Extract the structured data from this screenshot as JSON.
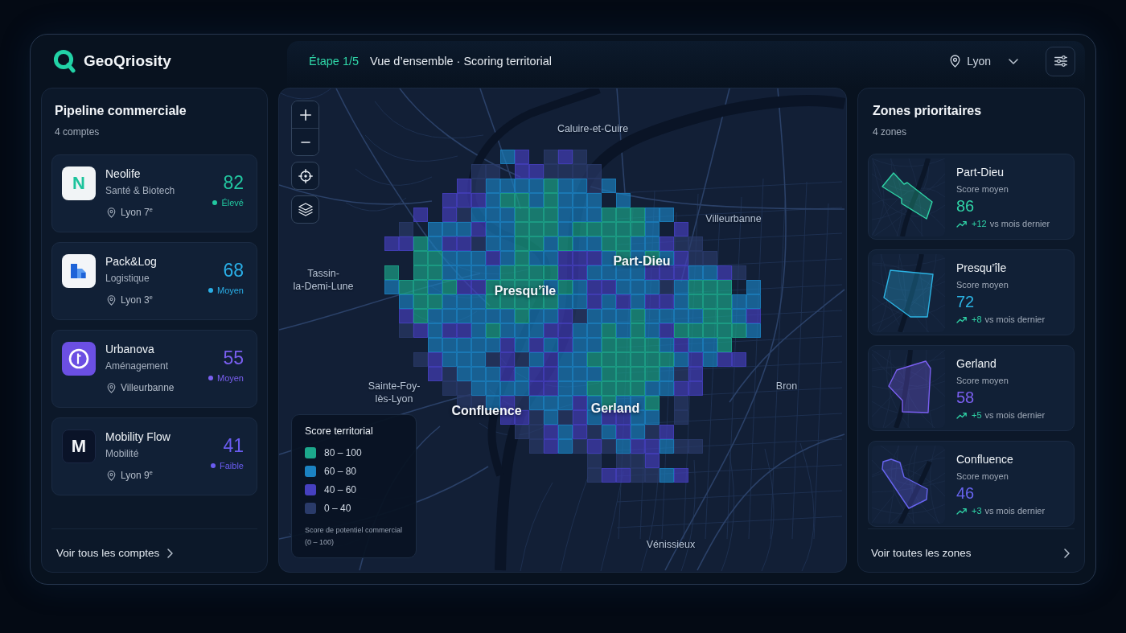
{
  "header": {
    "brand": "GeoQriosity",
    "step": "Étape 1/5",
    "title": "Vue d’ensemble · Scoring territorial",
    "city": "Lyon"
  },
  "pipeline": {
    "title": "Pipeline commerciale",
    "count": "4 comptes",
    "accounts": [
      {
        "name": "Neolife",
        "sector": "Santé & Biotech",
        "location": "Lyon 7$^{e}$",
        "score": "82",
        "status": "Élevé",
        "color": "#22c7a0",
        "logo": {
          "kind": "letter-light",
          "text": "N"
        }
      },
      {
        "name": "Pack&Log",
        "sector": "Logistique",
        "location": "Lyon 3$^{e}$",
        "score": "68",
        "status": "Moyen",
        "color": "#2aaee6",
        "logo": {
          "kind": "building"
        }
      },
      {
        "name": "Urbanova",
        "sector": "Aménagement",
        "location": "Villeurbanne",
        "score": "55",
        "status": "Moyen",
        "color": "#7a5ff0",
        "logo": {
          "kind": "ring"
        }
      },
      {
        "name": "Mobility Flow",
        "sector": "Mobilité",
        "location": "Lyon 9$^{e}$",
        "score": "41",
        "status": "Faible",
        "color": "#6a5cf0",
        "logo": {
          "kind": "letter-dark",
          "text": "M"
        }
      }
    ],
    "link": "Voir tous les comptes"
  },
  "map": {
    "labels": [
      {
        "text": "Caluire-et-Cuire",
        "kind": "town"
      },
      {
        "text": "Villeurbanne",
        "kind": "town"
      },
      {
        "text": "Tassin-\nla-Demi-Lune",
        "kind": "town"
      },
      {
        "text": "Part-Dieu",
        "kind": "district"
      },
      {
        "text": "Presqu’île",
        "kind": "district"
      },
      {
        "text": "Sainte-Foy-\nlès-Lyon",
        "kind": "town"
      },
      {
        "text": "Confluence",
        "kind": "district"
      },
      {
        "text": "Gerland",
        "kind": "district"
      },
      {
        "text": "Bron",
        "kind": "town"
      },
      {
        "text": "Vénissieux",
        "kind": "town"
      }
    ],
    "legend": {
      "title": "Score territorial",
      "items": [
        {
          "label": "80 – 100",
          "color": "#1ca88c"
        },
        {
          "label": "60 – 80",
          "color": "#1b82c2"
        },
        {
          "label": "40 – 60",
          "color": "#4640c0"
        },
        {
          "label": "0 – 40",
          "color": "#2a3b6a"
        }
      ],
      "note": "Score de potentiel commercial (0 – 100)"
    }
  },
  "zones": {
    "title": "Zones prioritaires",
    "count": "4 zones",
    "items": [
      {
        "name": "Part-Dieu",
        "metric": "Score moyen",
        "score": "86",
        "change": "+12",
        "comparison": "vs mois dernier",
        "color": "#2fd3a6"
      },
      {
        "name": "Presqu’île",
        "metric": "Score moyen",
        "score": "72",
        "change": "+8",
        "comparison": "vs mois dernier",
        "color": "#2cb4e4"
      },
      {
        "name": "Gerland",
        "metric": "Score moyen",
        "score": "58",
        "change": "+5",
        "comparison": "vs mois dernier",
        "color": "#7a5ff0"
      },
      {
        "name": "Confluence",
        "metric": "Score moyen",
        "score": "46",
        "change": "+3",
        "comparison": "vs mois dernier",
        "color": "#6764ef"
      }
    ],
    "link": "Voir toutes les zones"
  }
}
